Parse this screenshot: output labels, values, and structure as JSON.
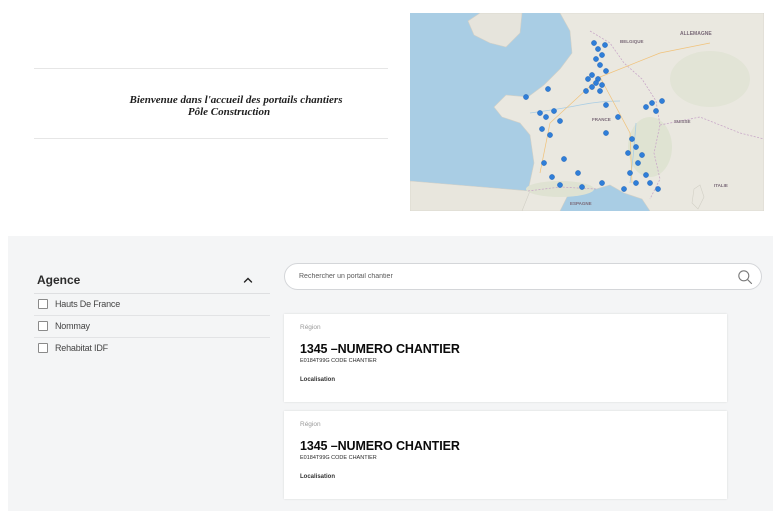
{
  "welcome": {
    "line1": "Bienvenue dans l'accueil des portails chantiers",
    "line2": "Pôle Construction"
  },
  "map": {
    "labels": [
      "ALLEMAGNE",
      "BELGIQUE",
      "FRANCE",
      "SUISSE",
      "ITALIE",
      "ESPAGNE"
    ],
    "marker_color": "#2f7ed8"
  },
  "filter": {
    "title": "Agence",
    "items": [
      {
        "label": "Hauts De France"
      },
      {
        "label": "Nommay"
      },
      {
        "label": "Rehabitat IDF"
      }
    ]
  },
  "search": {
    "placeholder": "Rechercher un portail chantier"
  },
  "cards": [
    {
      "region": "Région",
      "title": "1345 –NUMERO CHANTIER",
      "code": "E0184T99G CODE CHANTIER",
      "location": "Localisation"
    },
    {
      "region": "Région",
      "title": "1345 –NUMERO CHANTIER",
      "code": "E0184T99G CODE CHANTIER",
      "location": "Localisation"
    }
  ],
  "colors": {
    "bottom_background": "#f4f5f6",
    "marker": "#2f7ed8",
    "sea": "#a9cde4",
    "land": "#eae8e0"
  },
  "icons": {
    "collapse": "chevron-up-icon",
    "search": "search-icon"
  }
}
